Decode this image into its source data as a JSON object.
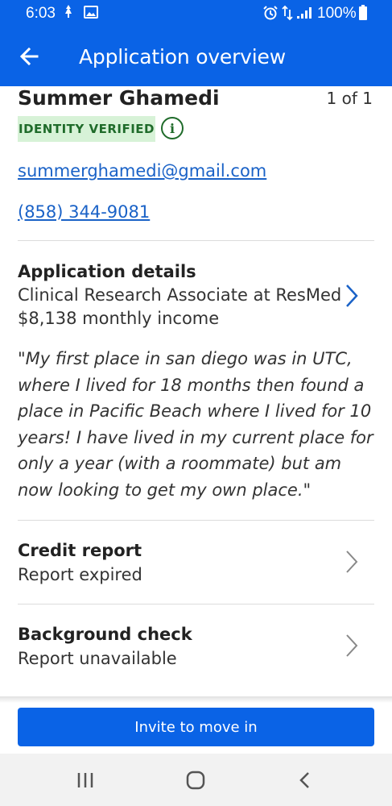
{
  "status_bar": {
    "time": "6:03",
    "battery_percent": "100%",
    "icons": [
      "notification-icon",
      "image-icon",
      "alarm-icon",
      "data-icon",
      "signal-icon",
      "battery-icon"
    ]
  },
  "app_bar": {
    "title": "Application overview",
    "back_icon": "back-arrow-icon",
    "color": "#0a63e6"
  },
  "applicant": {
    "name": "Summer Ghamedi",
    "pager": "1 of 1",
    "badge": "IDENTITY VERIFIED",
    "email": "summerghamedi@gmail.com",
    "phone": "(858) 344-9081"
  },
  "application_details": {
    "title": "Application details",
    "job": "Clinical Research Associate at ResMed",
    "income": "$8,138 monthly income",
    "quote": "\"My first place in san diego was in UTC, where I lived for 18 months then found a place in Pacific Beach where I lived for 10 years! I have lived in my current place for only a year (with a roommate) but am now looking to get my own place.\""
  },
  "credit_report": {
    "title": "Credit report",
    "status": "Report expired"
  },
  "background_check": {
    "title": "Background check",
    "status": "Report unavailable"
  },
  "actions": {
    "invite_label": "Invite to move in"
  },
  "nav": {
    "icons": [
      "recent-apps-icon",
      "home-icon",
      "back-icon"
    ]
  }
}
